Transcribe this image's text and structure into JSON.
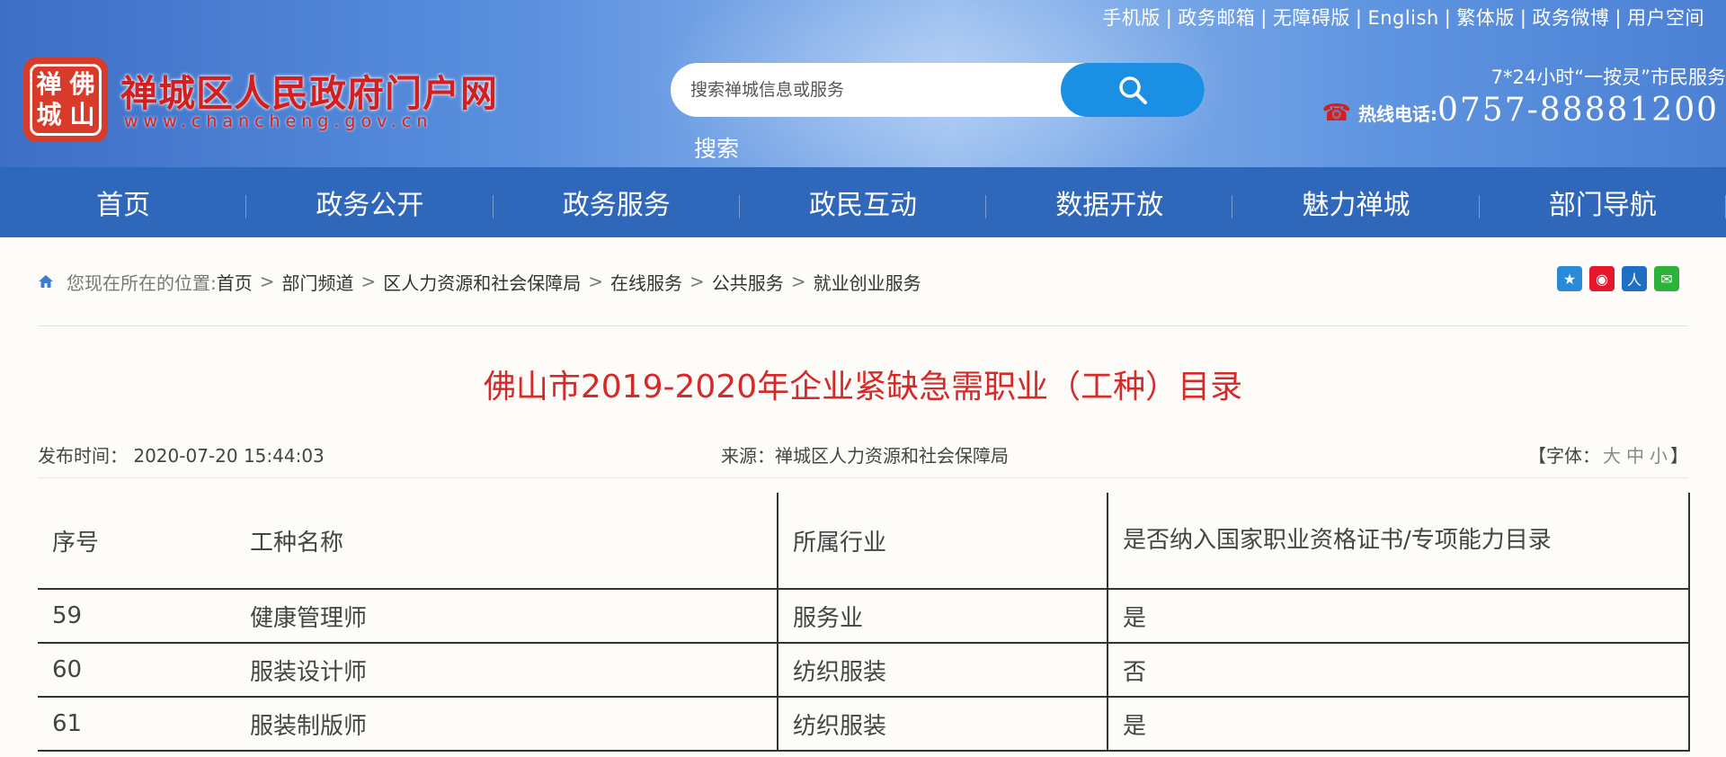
{
  "header": {
    "top_links": [
      "手机版",
      "政务邮箱",
      "无障碍版",
      "English",
      "繁体版",
      "政务微博",
      "用户空间"
    ],
    "logo_chars": [
      "禅",
      "佛",
      "城",
      "山"
    ],
    "site_title": "禅城区人民政府门户网",
    "site_url": "www.chancheng.gov.cn",
    "search_placeholder": "搜索禅城信息或服务",
    "search_label": "搜索",
    "hotline_top": "7*24小时“一按灵”市民服务",
    "hotline_label": "热线电话:",
    "hotline_number": "0757-88881200"
  },
  "nav": {
    "items": [
      "首页",
      "政务公开",
      "政务服务",
      "政民互动",
      "数据开放",
      "魅力禅城",
      "部门导航"
    ]
  },
  "breadcrumb": {
    "here": "您现在所在的位置:",
    "items": [
      "首页",
      "部门频道",
      "区人力资源和社会保障局",
      "在线服务",
      "公共服务",
      "就业创业服务"
    ]
  },
  "share": [
    "qzone-icon",
    "weibo-icon",
    "renren-icon",
    "wechat-icon"
  ],
  "article": {
    "title": "佛山市2019-2020年企业紧缺急需职业（工种）目录",
    "publish_label": "发布时间：",
    "publish_time": "2020-07-20 15:44:03",
    "source": "来源：禅城区人力资源和社会保障局",
    "font_label": "【字体：",
    "font_large": "大",
    "font_medium": "中",
    "font_small": "小",
    "font_close": "】"
  },
  "table": {
    "headers": [
      "序号",
      "工种名称",
      "所属行业",
      "是否纳入国家职业资格证书/专项能力目录"
    ],
    "rows": [
      [
        "59",
        "健康管理师",
        "服务业",
        "是"
      ],
      [
        "60",
        "服装设计师",
        "纺织服装",
        "否"
      ],
      [
        "61",
        "服装制版师",
        "纺织服装",
        "是"
      ]
    ]
  }
}
